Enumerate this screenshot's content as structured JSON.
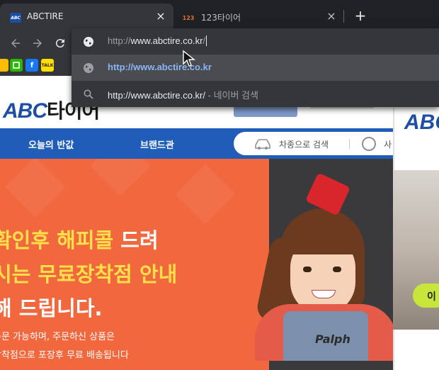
{
  "tabs": [
    {
      "title": "ABCTIRE",
      "favicon": "ABC",
      "active": true
    },
    {
      "title": "123타이어",
      "favicon": "123",
      "active": false
    }
  ],
  "toolbar": {
    "back": "back-arrow-icon",
    "forward": "forward-arrow-icon",
    "reload": "reload-icon"
  },
  "omnibox": {
    "prefix": "http://",
    "domain": "www.abctire.co.kr",
    "suffix": "/",
    "suggestions": [
      {
        "text": "http://www.abctire.co.kr",
        "icon": "globe-icon"
      },
      {
        "text": "http://www.abctire.co.kr/",
        "sub": "- 네이버 검색",
        "icon": "search-icon"
      }
    ]
  },
  "site": {
    "logo_en": "ABC",
    "logo_kr": "타이어",
    "nav": [
      "오늘의 반값",
      "브랜드관"
    ],
    "search_car": "차종으로 검색",
    "search_size_partial": "사",
    "banner": {
      "line1_pre": "확인후 해피콜",
      "line1_post": "드려",
      "line2": "시는 무료장착점 안내",
      "line3": "해 드립니다.",
      "small1": "주문 가능하며, 주문하신 상품은",
      "small2": "장착점으로 포장후 무료 배송됩니다",
      "overall_text": "Palph"
    },
    "right_panel": {
      "logo": "ABC",
      "button_partial": "이"
    }
  }
}
